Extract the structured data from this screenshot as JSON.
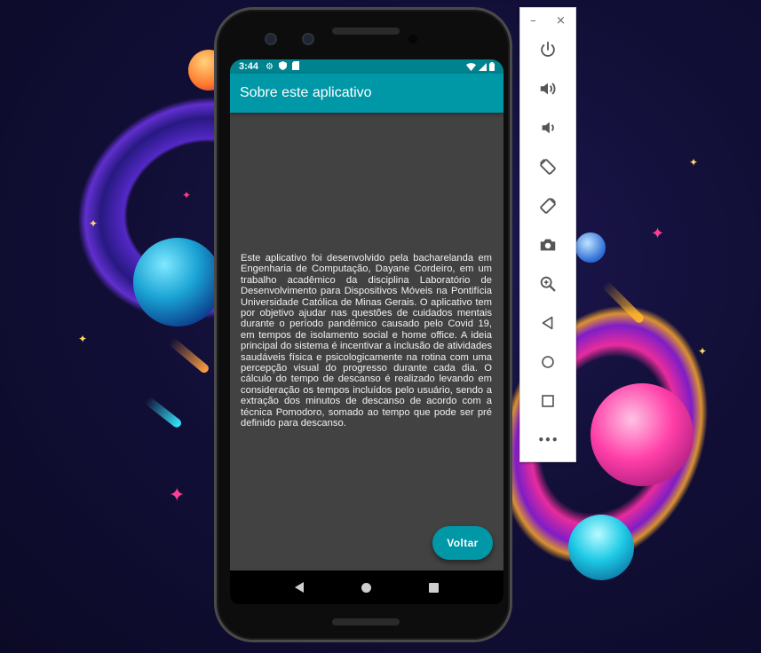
{
  "phone": {
    "status_bar": {
      "time": "3:44"
    },
    "app_bar": {
      "title": "Sobre este aplicativo"
    },
    "about_text": "Este aplicativo foi desenvolvido pela bacharelanda em Engenharia de Computação, Dayane Cordeiro, em um trabalho acadêmico da disciplina Laboratório de Desenvolvimento para Dispositivos Móveis na Pontifícia Universidade Católica de Minas Gerais. O aplicativo tem por objetivo ajudar nas questões de cuidados mentais durante o período pandêmico causado pelo Covid 19, em tempos de isolamento social e home office. A ideia principal do sistema é incentivar a inclusão de atividades saudáveis física e psicologicamente na rotina com uma percepção visual do progresso durante cada dia. O cálculo do tempo de descanso é realizado levando em consideração os tempos incluídos pelo usuário, sendo a extração dos minutos de descanso de acordo com a técnica Pomodoro, somado ao tempo que pode ser pré definido para descanso.",
    "back_button_label": "Voltar"
  },
  "emulator_toolbar": {
    "minimize_label": "–",
    "close_label": "×",
    "more_label": "•••"
  },
  "colors": {
    "status_bar": "#00838f",
    "app_bar": "#0097a7",
    "screen_background": "#424242",
    "fab": "#0097a7"
  },
  "icons": {
    "status_bar": [
      "gear-icon",
      "shield-icon",
      "sim-card-icon",
      "wifi-icon",
      "signal-icon",
      "battery-icon"
    ],
    "navigation": [
      "back-icon",
      "home-icon",
      "recent-apps-icon"
    ],
    "emulator_toolbar": [
      "power-icon",
      "volume-up-icon",
      "volume-down-icon",
      "rotate-left-icon",
      "rotate-right-icon",
      "camera-icon",
      "zoom-icon",
      "back-icon",
      "home-icon",
      "overview-icon",
      "more-icon"
    ]
  }
}
